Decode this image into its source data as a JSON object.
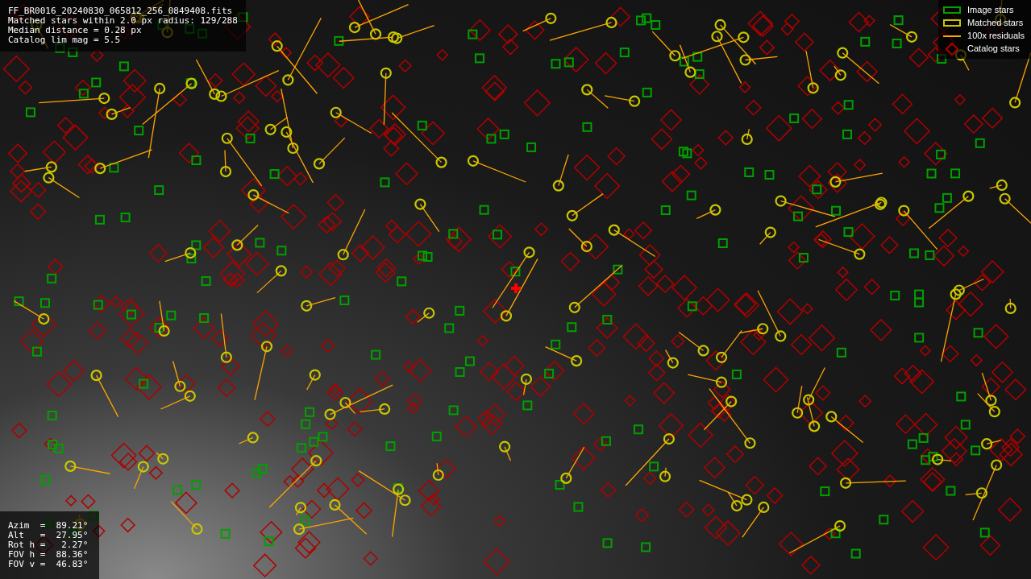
{
  "info_panel": {
    "lines": [
      "FF_BR0016_20240830_065812_256_0849408.fits",
      "Matched stars within 2.0 px radius: 129/288",
      "Median distance = 0.28 px",
      "Catalog lim mag = 5.5"
    ]
  },
  "legend": [
    {
      "kind": "box",
      "label": "Image stars",
      "color": "#00a000"
    },
    {
      "kind": "box",
      "label": "Matched stars",
      "color": "#c8c800"
    },
    {
      "kind": "line",
      "label": "100x residuals",
      "color": "#ffa500"
    },
    {
      "kind": "diamond",
      "label": "Catalog stars",
      "color": "#b00000"
    }
  ],
  "pointing_panel": {
    "lines": [
      "Azim  =  89.21°",
      "Alt   =  27.95°",
      "Rot h =   2.27°",
      "FOV h =  88.36°",
      "FOV v =  46.83°"
    ]
  }
}
